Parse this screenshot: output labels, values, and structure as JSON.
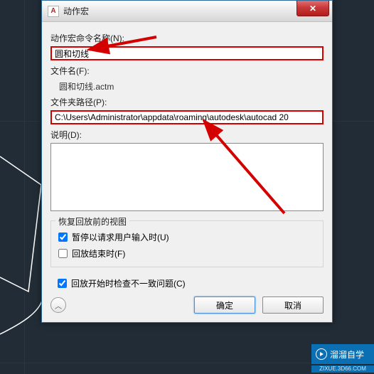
{
  "window_title": "动作宏",
  "app_icon_letter": "A",
  "close_symbol": "✕",
  "labels": {
    "command_name": "动作宏命令名称(N):",
    "filename": "文件名(F):",
    "folder_path": "文件夹路径(P):",
    "description": "说明(D):"
  },
  "values": {
    "command_name": "圆和切线",
    "filename": "圆和切线.actm",
    "folder_path": "C:\\Users\\Administrator\\appdata\\roaming\\autodesk\\autocad 20"
  },
  "group": {
    "title": "恢复回放前的视图",
    "pause_label": "暂停以请求用户输入时(U)",
    "end_label": "回放结束时(F)",
    "pause_checked": true,
    "end_checked": false
  },
  "bottom": {
    "check_label": "回放开始时检查不一致问题(C)",
    "checked": true,
    "expand": "︿",
    "ok": "确定",
    "cancel": "取消"
  },
  "watermark": {
    "main": "溜溜自学",
    "sub": "ZIXUE.3D66.COM"
  }
}
